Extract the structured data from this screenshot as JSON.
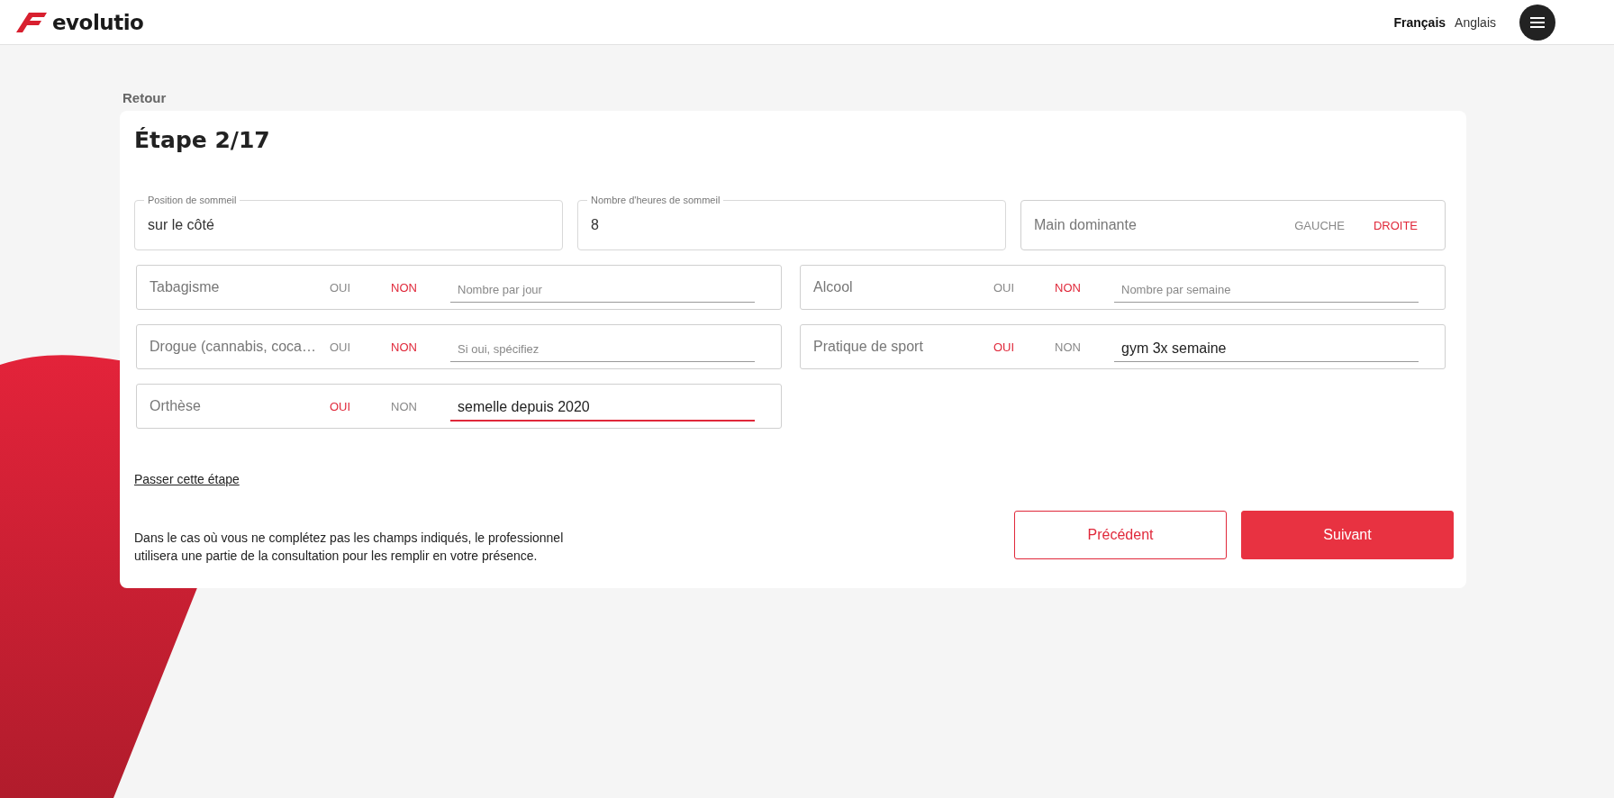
{
  "header": {
    "logo": "evolutio",
    "languages": [
      {
        "label": "Français",
        "selected": true
      },
      {
        "label": "Anglais",
        "selected": false
      }
    ]
  },
  "back_link": "Retour",
  "title": "Étape 2/17",
  "top_fields": [
    {
      "kind": "text",
      "label": "Position de sommeil",
      "value": "sur le côté"
    },
    {
      "kind": "text",
      "label": "Nombre d'heures de sommeil",
      "value": "8"
    },
    {
      "kind": "choice",
      "label": "Main dominante",
      "options": [
        {
          "label": "GAUCHE",
          "selected": false
        },
        {
          "label": "DROITE",
          "selected": true
        }
      ]
    }
  ],
  "toggle_fields": [
    {
      "label": "Tabagisme",
      "options": [
        {
          "label": "OUI",
          "selected": false
        },
        {
          "label": "NON",
          "selected": true
        }
      ],
      "detail": {
        "placeholder": "Nombre par jour"
      },
      "focused": false
    },
    {
      "label": "Alcool",
      "options": [
        {
          "label": "OUI",
          "selected": false
        },
        {
          "label": "NON",
          "selected": true
        }
      ],
      "detail": {
        "placeholder": "Nombre par semaine"
      },
      "focused": false
    },
    {
      "label": "Drogue (cannabis, coca…",
      "options": [
        {
          "label": "OUI",
          "selected": false
        },
        {
          "label": "NON",
          "selected": true
        }
      ],
      "detail": {
        "placeholder": "Si oui, spécifiez"
      },
      "focused": false
    },
    {
      "label": "Pratique de sport",
      "options": [
        {
          "label": "OUI",
          "selected": true
        },
        {
          "label": "NON",
          "selected": false
        }
      ],
      "detail": {
        "value": "gym 3x semaine"
      },
      "focused": false
    },
    {
      "label": "Orthèse",
      "options": [
        {
          "label": "OUI",
          "selected": true
        },
        {
          "label": "NON",
          "selected": false
        }
      ],
      "detail": {
        "value": "semelle depuis 2020"
      },
      "focused": true
    }
  ],
  "skip_link": "Passer cette étape",
  "notice": "Dans le cas où vous ne complétez pas les champs indiqués, le professionnel utilisera une partie de la consultation pour les remplir en votre présence.",
  "buttons": [
    {
      "label": "Précédent",
      "kind": "secondary"
    },
    {
      "label": "Suivant",
      "kind": "primary"
    }
  ]
}
